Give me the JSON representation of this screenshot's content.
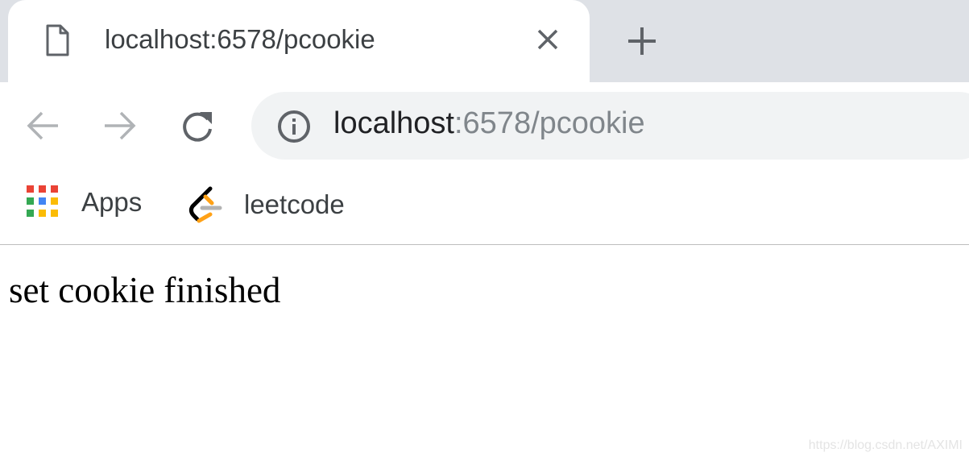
{
  "tab": {
    "title": "localhost:6578/pcookie",
    "icon": "document-icon"
  },
  "omnibox": {
    "host": "localhost",
    "rest": ":6578/pcookie",
    "icon": "info-icon"
  },
  "bookmarks": [
    {
      "label": "Apps",
      "icon": "apps-grid-icon"
    },
    {
      "label": "leetcode",
      "icon": "leetcode-icon"
    }
  ],
  "content": {
    "text": "set cookie finished"
  },
  "watermark": "https://blog.csdn.net/AXIMI"
}
